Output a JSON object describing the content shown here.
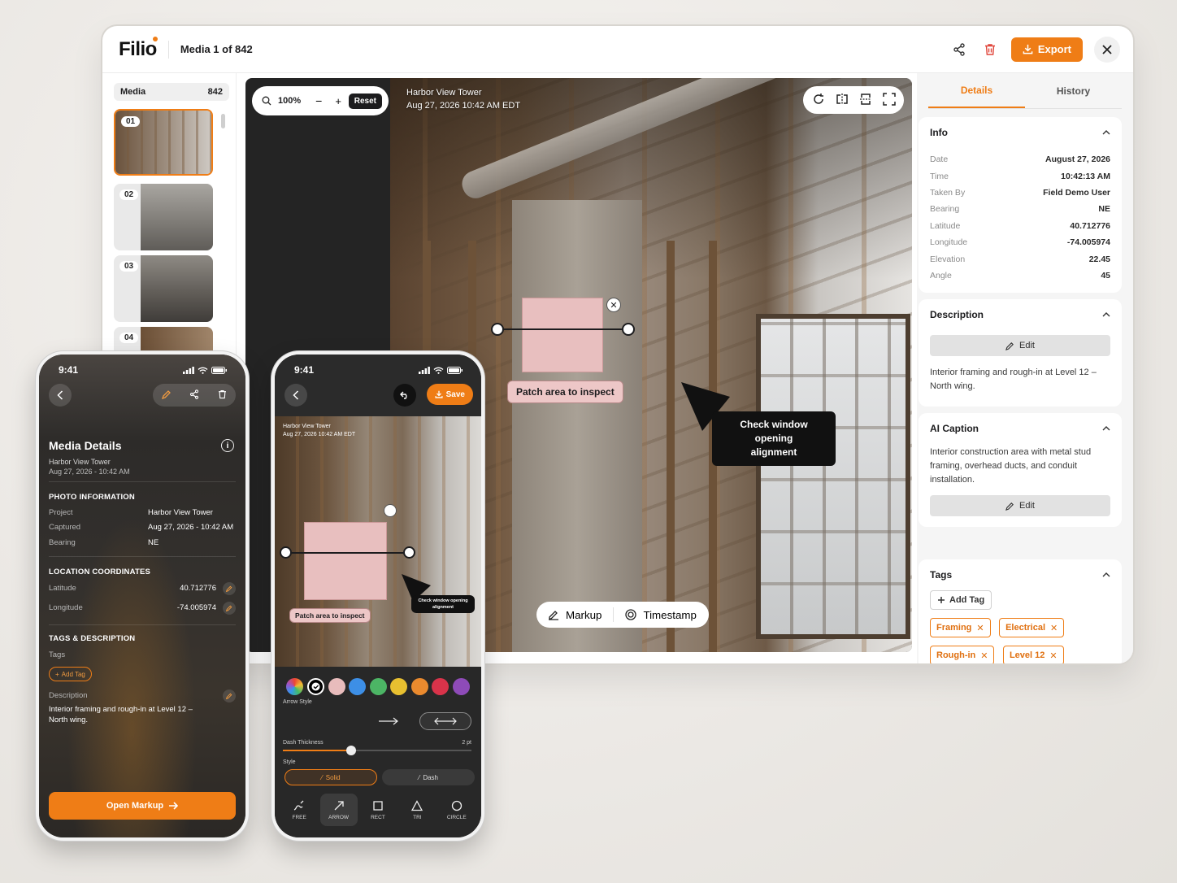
{
  "app": {
    "logo": "Filio",
    "media_title": "Media 1 of 842",
    "export_label": "Export",
    "accent": "#ef7d16"
  },
  "strip": {
    "header_label": "Media",
    "header_count": "842",
    "thumbs": [
      {
        "num": "01",
        "active": true
      },
      {
        "num": "02"
      },
      {
        "num": "03"
      },
      {
        "num": "04"
      }
    ]
  },
  "viewer": {
    "zoom": "100%",
    "zoom_out": "−",
    "zoom_in": "+",
    "reset_label": "Reset",
    "caption_title": "Harbor View Tower",
    "caption_date": "Aug 27, 2026 10:42 AM EDT",
    "markup_label": "Markup",
    "timestamp_label": "Timestamp",
    "annotations": {
      "rect_label": "Patch area to inspect",
      "note_line1": "Check window opening",
      "note_line2": "alignment",
      "close_glyph": "✕"
    }
  },
  "details": {
    "tabs": [
      "Details",
      "History"
    ],
    "info_title": "Info",
    "info": [
      {
        "k": "Date",
        "v": "August 27, 2026"
      },
      {
        "k": "Time",
        "v": "10:42:13 AM"
      },
      {
        "k": "Taken By",
        "v": "Field Demo User"
      },
      {
        "k": "Bearing",
        "v": "NE"
      },
      {
        "k": "Latitude",
        "v": "40.712776"
      },
      {
        "k": "Longitude",
        "v": "-74.005974"
      },
      {
        "k": "Elevation",
        "v": "22.45"
      },
      {
        "k": "Angle",
        "v": "45"
      }
    ],
    "description_title": "Description",
    "edit_label": "Edit",
    "description_text": "Interior framing and rough-in at Level 12 – North wing.",
    "ai_title": "AI Caption",
    "ai_text": "Interior construction area with metal stud framing, overhead ducts, and conduit installation.",
    "tags_title": "Tags",
    "add_tag_label": "Add Tag",
    "tags": [
      "Framing",
      "Electrical",
      "Rough-in",
      "Level 12"
    ]
  },
  "phone1": {
    "time": "9:41",
    "title": "Media Details",
    "sub_project": "Harbor View Tower",
    "sub_date": "Aug 27, 2026 - 10:42 AM",
    "info_glyph": "i",
    "photo_section": "PHOTO INFORMATION",
    "photo_rows": [
      {
        "k": "Project",
        "v": "Harbor View Tower"
      },
      {
        "k": "Captured",
        "v": "Aug 27, 2026 - 10:42 AM"
      },
      {
        "k": "Bearing",
        "v": "NE"
      }
    ],
    "location_section": "LOCATION COORDINATES",
    "location_rows": [
      {
        "k": "Latitude",
        "v": "40.712776"
      },
      {
        "k": "Longitude",
        "v": "-74.005974"
      }
    ],
    "tags_section": "TAGS & DESCRIPTION",
    "tags_label": "Tags",
    "add_tag_label": "Add Tag",
    "description_label": "Description",
    "description_text": "Interior framing and rough-in at Level 12 – North wing.",
    "open_markup_label": "Open Markup"
  },
  "phone2": {
    "time": "9:41",
    "save_label": "Save",
    "caption_title": "Harbor View Tower",
    "caption_date": "Aug 27, 2026 10:42 AM EDT",
    "rect_label": "Patch area to inspect",
    "note_line1": "Check window opening",
    "note_line2": "alignment",
    "swatches": [
      "#000000",
      "#e8bcbc",
      "#3d8fe6",
      "#4cb565",
      "#e8c030",
      "#ea8a2e",
      "#d9334a",
      "#8e4bb8"
    ],
    "arrow_style_label": "Arrow Style",
    "dash_thickness_label": "Dash Thickness",
    "dash_thickness_value": "2 pt",
    "dash_thickness_fraction": 0.36,
    "style_label": "Style",
    "solid_label": "Solid",
    "dash_label": "Dash",
    "tools": [
      {
        "label": "FREE",
        "icon": "freehand-icon"
      },
      {
        "label": "ARROW",
        "icon": "arrow-icon",
        "active": true
      },
      {
        "label": "RECT",
        "icon": "rectangle-icon"
      },
      {
        "label": "TRI",
        "icon": "triangle-icon"
      },
      {
        "label": "CIRCLE",
        "icon": "circle-icon"
      }
    ]
  }
}
